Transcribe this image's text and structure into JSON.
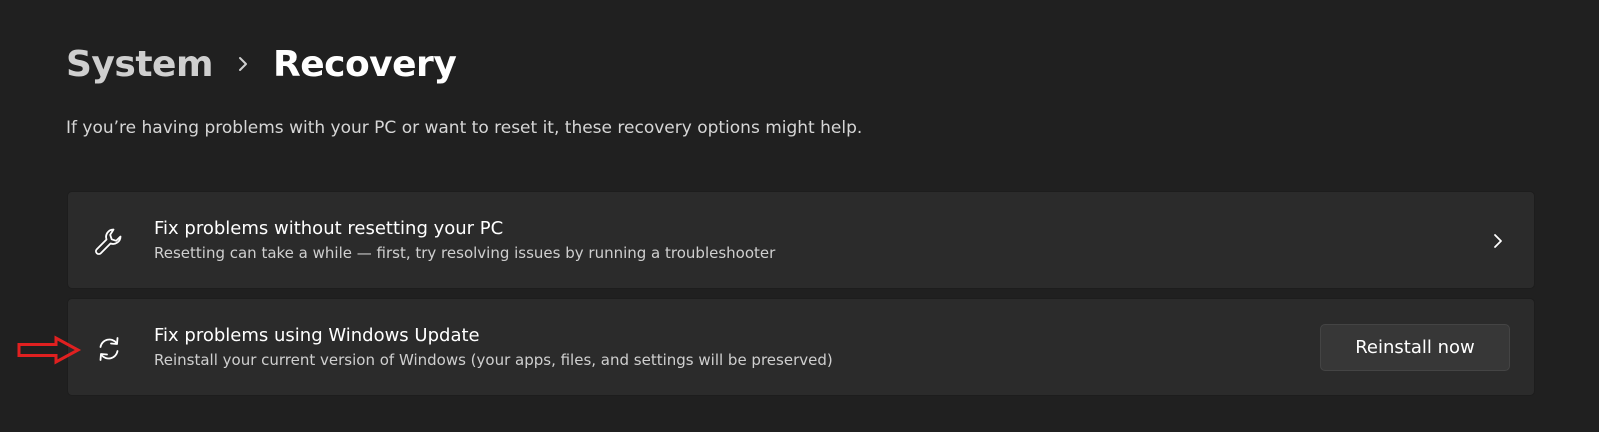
{
  "breadcrumb": {
    "parent": "System",
    "current": "Recovery"
  },
  "intro": "If you’re having problems with your PC or want to reset it, these recovery options might help.",
  "options": [
    {
      "icon": "wrench-icon",
      "title": "Fix problems without resetting your PC",
      "description": "Resetting can take a while — first, try resolving issues by running a troubleshooter",
      "action": "chevron-right"
    },
    {
      "icon": "sync-icon",
      "title": "Fix problems using Windows Update",
      "description": "Reinstall your current version of Windows (your apps, files, and settings will be preserved)",
      "button_label": "Reinstall now"
    }
  ],
  "annotation": {
    "icon": "red-arrow-icon",
    "color": "#e02020"
  },
  "colors": {
    "background": "#202020",
    "card": "#2b2b2b",
    "button": "#373737"
  }
}
